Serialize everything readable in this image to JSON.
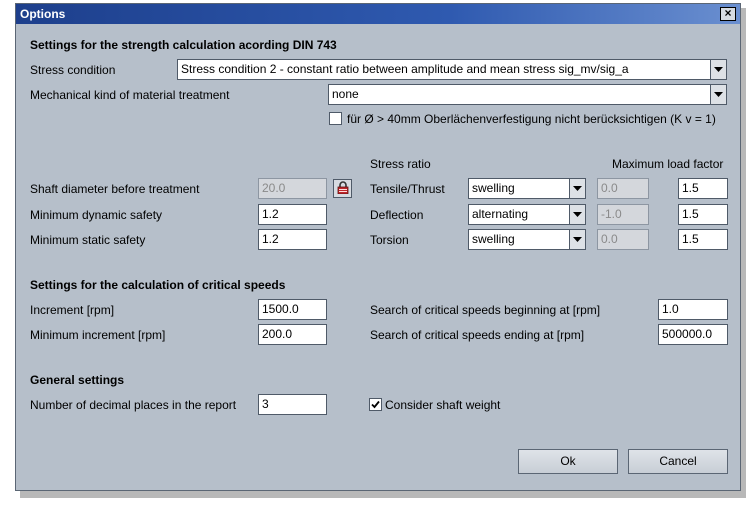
{
  "window": {
    "title": "Options",
    "close_glyph": "×"
  },
  "strength": {
    "heading": "Settings for the strength calculation acording DIN 743",
    "stress_condition_label": "Stress condition",
    "stress_condition_value": "Stress condition 2 - constant ratio between amplitude and mean stress sig_mv/sig_a",
    "material_treatment_label": "Mechanical kind of material treatment",
    "material_treatment_value": "none",
    "surface_checkbox_label": "für Ø > 40mm Oberlächenverfestigung nicht berücksichtigen (K v = 1)",
    "surface_checkbox_checked": false,
    "stress_ratio_header": "Stress ratio",
    "max_load_factor_header": "Maximum load factor",
    "shaft_diameter_label": "Shaft diameter before treatment",
    "shaft_diameter_value": "20.0",
    "min_dynamic_safety_label": "Minimum dynamic safety",
    "min_dynamic_safety_value": "1.2",
    "min_static_safety_label": "Minimum static safety",
    "min_static_safety_value": "1.2",
    "rows": [
      {
        "label": "Tensile/Thrust",
        "ratio_type": "swelling",
        "ratio_value": "0.0",
        "load_factor": "1.5"
      },
      {
        "label": "Deflection",
        "ratio_type": "alternating",
        "ratio_value": "-1.0",
        "load_factor": "1.5"
      },
      {
        "label": "Torsion",
        "ratio_type": "swelling",
        "ratio_value": "0.0",
        "load_factor": "1.5"
      }
    ]
  },
  "critical": {
    "heading": "Settings for the calculation of critical speeds",
    "increment_label": "Increment [rpm]",
    "increment_value": "1500.0",
    "min_increment_label": "Minimum increment [rpm]",
    "min_increment_value": "200.0",
    "begin_label": "Search of critical speeds beginning at [rpm]",
    "begin_value": "1.0",
    "end_label": "Search of critical speeds ending at [rpm]",
    "end_value": "500000.0"
  },
  "general": {
    "heading": "General settings",
    "decimal_places_label": "Number of decimal places in the report",
    "decimal_places_value": "3",
    "shaft_weight_label": "Consider shaft weight",
    "shaft_weight_checked": true
  },
  "buttons": {
    "ok": "Ok",
    "cancel": "Cancel"
  },
  "icons": {
    "lock": "lock-icon",
    "dropdown": "chevron-down-icon",
    "check": "check-icon",
    "close": "close-icon"
  },
  "colors": {
    "window_bg": "#b6bfca",
    "title_bar": "#1d3f8c",
    "field_bg": "#ffffff",
    "disabled_field_bg": "#d4d7dc"
  }
}
